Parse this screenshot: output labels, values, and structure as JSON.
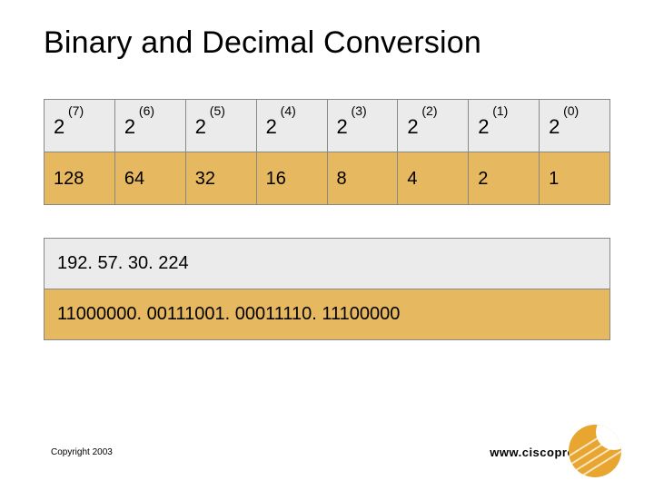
{
  "title": "Binary and Decimal Conversion",
  "chart_data": {
    "type": "table",
    "powers": {
      "exponents": [
        "(7)",
        "(6)",
        "(5)",
        "(4)",
        "(3)",
        "(2)",
        "(1)",
        "(0)"
      ],
      "base": "2",
      "values": [
        "128",
        "64",
        "32",
        "16",
        "8",
        "4",
        "2",
        "1"
      ]
    },
    "ip": {
      "decimal": "192. 57. 30. 224",
      "binary": "11000000. 00111001. 00011110. 11100000"
    }
  },
  "footer": {
    "copyright": "Copyright 2003",
    "url": "www.ciscopress.com"
  }
}
